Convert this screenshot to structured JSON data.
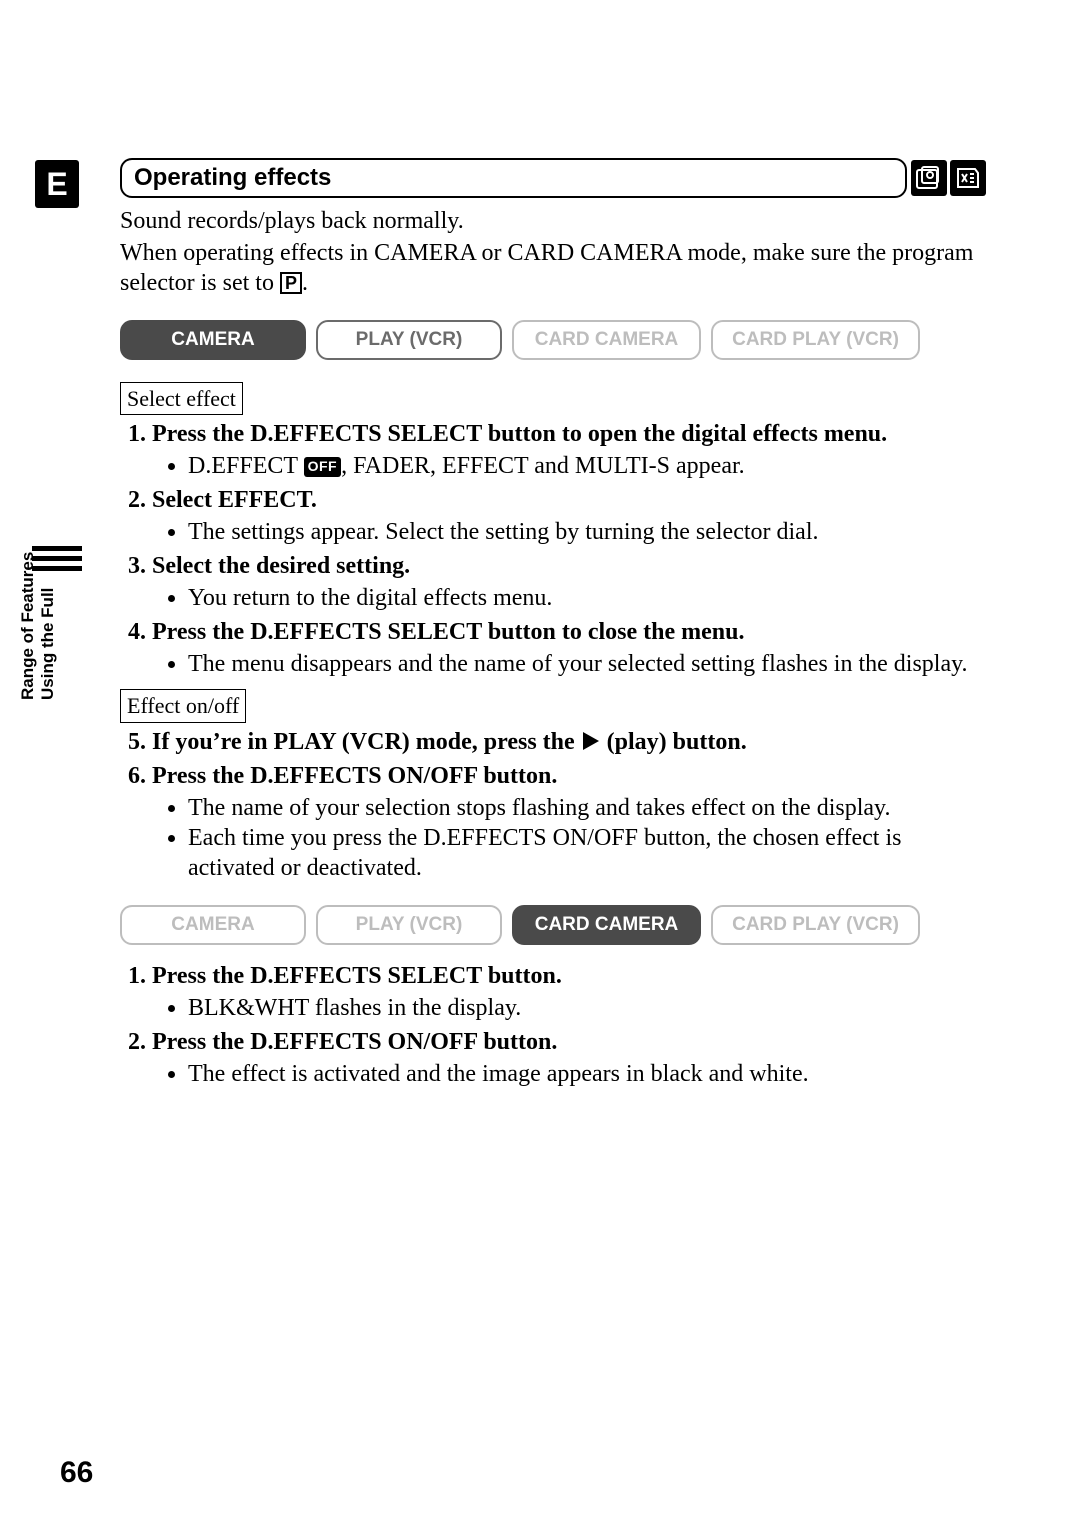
{
  "page_number": "66",
  "e_tab": "E",
  "side_label": "Using the Full\nRange of Features",
  "side_label_line1": "Using the Full",
  "side_label_line2": "Range of Features",
  "title": "Operating effects",
  "intro": {
    "line1": "Sound records/plays back normally.",
    "line2_a": "When operating effects in CAMERA or CARD CAMERA mode, make sure the program selector is set to ",
    "p_mark": "P",
    "line2_b": "."
  },
  "modes1": {
    "camera": "CAMERA",
    "playvcr": "PLAY (VCR)",
    "cardcam": "CARD CAMERA",
    "cardplay": "CARD PLAY (VCR)"
  },
  "label_select_effect": "Select effect",
  "off_chip": "OFF",
  "steps_a": {
    "s1": "Press the D.EFFECTS SELECT button to open the digital effects menu.",
    "s1_b1a": "D.EFFECT ",
    "s1_b1b": ", FADER, EFFECT and MULTI-S appear.",
    "s2": "Select EFFECT.",
    "s2_b1": "The settings appear.  Select the setting by turning the selector dial.",
    "s3": "Select the desired setting.",
    "s3_b1": "You return to the digital effects menu.",
    "s4": "Press the D.EFFECTS SELECT button to close the menu.",
    "s4_b1": "The menu disappears and the name of your selected setting flashes in the display."
  },
  "label_effect_onoff": "Effect on/off",
  "steps_b": {
    "s5a": "If you’re in PLAY (VCR) mode, press the ",
    "s5b": " (play) button.",
    "s6": "Press the D.EFFECTS ON/OFF button.",
    "s6_b1": "The name of your selection stops flashing and takes effect on the display.",
    "s6_b2": "Each time you press the D.EFFECTS ON/OFF button, the chosen effect is activated or deactivated."
  },
  "modes2": {
    "camera": "CAMERA",
    "playvcr": "PLAY (VCR)",
    "cardcam": "CARD CAMERA",
    "cardplay": "CARD PLAY (VCR)"
  },
  "steps_c": {
    "s1": "Press the D.EFFECTS SELECT button.",
    "s1_b1": "BLK&WHT flashes in the display.",
    "s2": "Press the D.EFFECTS ON/OFF button.",
    "s2_b1": "The effect is activated and the image appears in black and white."
  }
}
